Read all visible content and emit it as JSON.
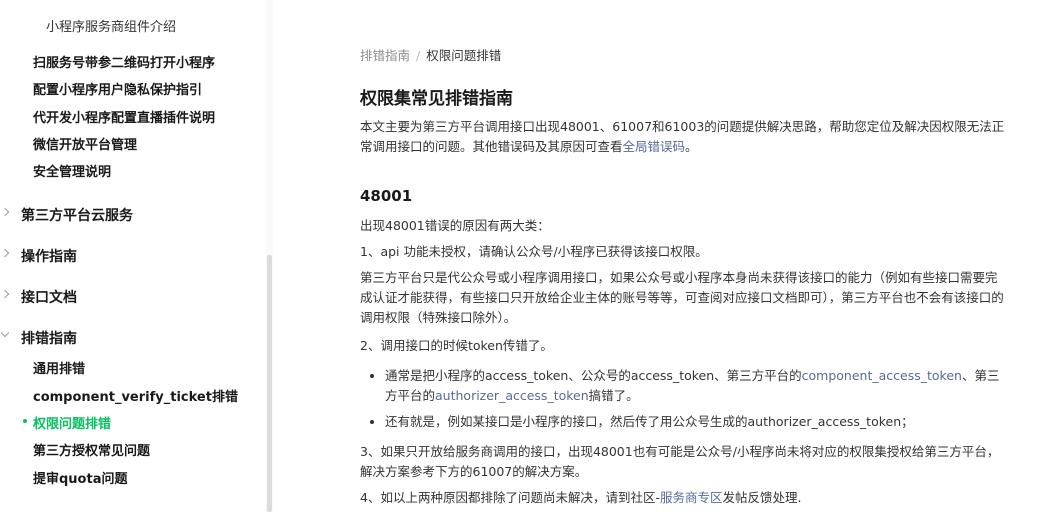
{
  "sidebar": {
    "top_item": "小程序服务商组件介绍",
    "items_a": [
      "扫服务号带参二维码打开小程序",
      "配置小程序用户隐私保护指引",
      "代开发小程序配置直播插件说明",
      "微信开放平台管理",
      "安全管理说明"
    ],
    "sections": {
      "cloud": "第三方平台云服务",
      "guide": "操作指南",
      "api": "接口文档",
      "troubleshoot": "排错指南"
    },
    "items_b": [
      "通用排错",
      "component_verify_ticket排错",
      "权限问题排错",
      "第三方授权常见问题",
      "提审quota问题"
    ]
  },
  "breadcrumb": {
    "parent": "排错指南",
    "separator": "/",
    "current": "权限问题排错"
  },
  "article": {
    "title": "权限集常见排错指南",
    "intro": "本文主要为第三方平台调用接口出现48001、61007和61003的问题提供解决思路，帮助您定位及解决因权限无法正常调用接口的问题。其他错误码及其原因可查看",
    "intro_link": "全局错误码",
    "intro_end": "。",
    "section_title": "48001",
    "reasons_intro": "出现48001错误的原因有两大类：",
    "reason1": "1、api 功能未授权，请确认公众号/小程序已获得该接口权限。",
    "reason1_detail": "第三方平台只是代公众号或小程序调用接口，如果公众号或小程序本身尚未获得该接口的能力（例如有些接口需要完成认证才能获得，有些接口只开放给企业主体的账号等等，可查阅对应接口文档即可），第三方平台也不会有该接口的调用权限（特殊接口除外）。",
    "reason2": "2、调用接口的时候token传错了。",
    "bullet1_a": "通常是把小程序的access_token、公众号的access_token、第三方平台的",
    "bullet1_link1": "component_access_token",
    "bullet1_b": "、第三方平台的",
    "bullet1_link2": "authorizer_access_token",
    "bullet1_c": "搞错了。",
    "bullet2": "还有就是，例如某接口是小程序的接口，然后传了用公众号生成的authorizer_access_token；",
    "reason3": "3、如果只开放给服务商调用的接口，出现48001也有可能是公众号/小程序尚未将对应的权限集授权给第三方平台，解决方案参考下方的61007的解决方案。",
    "reason4_a": "4、如以上两种原因都排除了问题尚未解决，请到社区-",
    "reason4_link": "服务商专区",
    "reason4_b": "发帖反馈处理."
  },
  "colors": {
    "accent": "#07c160",
    "link": "#576b95"
  }
}
